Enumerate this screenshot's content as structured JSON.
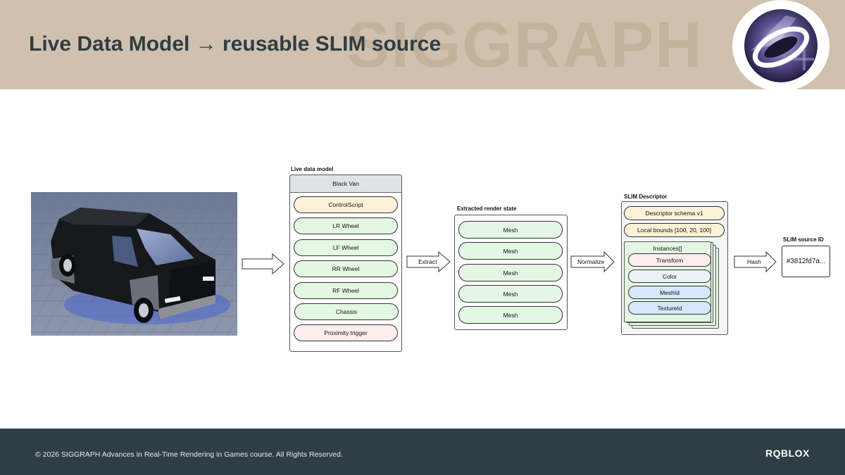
{
  "header": {
    "title": "Live Data Model → reusable SLIM source",
    "watermark": "SIGGRAPH",
    "logo_icon": "siggraph-logo-icon"
  },
  "diagram": {
    "live_model": {
      "label": "Live data model",
      "root": "Black Van",
      "items": [
        "ControlScript",
        "LR Wheel",
        "LF Wheel",
        "RR Wheel",
        "RF Wheel",
        "Chassis",
        "Proximity trigger"
      ]
    },
    "arrows": {
      "extract": "Extract",
      "normalize": "Normalize",
      "hash": "Hash"
    },
    "render_state": {
      "label": "Extracted render state",
      "items": [
        "Mesh",
        "Mesh",
        "Mesh",
        "Mesh",
        "Mesh"
      ]
    },
    "descriptor": {
      "label": "SLIM Descriptor",
      "schema": "Descriptor schema v1",
      "bounds": "Local bounds [100, 20, 100]",
      "instances_label": "Instances[]",
      "instance_fields": [
        "Transform",
        "Color",
        "MeshId",
        "TextureId"
      ]
    },
    "source_id": {
      "label": "SLIM source ID",
      "value": "#3812fd7a..."
    }
  },
  "footer": {
    "copyright": "© 2026 SIGGRAPH Advances in Real-Time Rendering in Games course. All Rights Reserved.",
    "brand": "RQBLOX"
  },
  "colors": {
    "header_bg": "#cfc1ad",
    "footer_bg": "#2f3d44",
    "title": "#2f3d44",
    "pill_green": "#e4f7e2",
    "pill_yellow": "#fdf1d8",
    "pill_pink": "#fdeeed",
    "pill_blue": "#d6e7fb"
  }
}
